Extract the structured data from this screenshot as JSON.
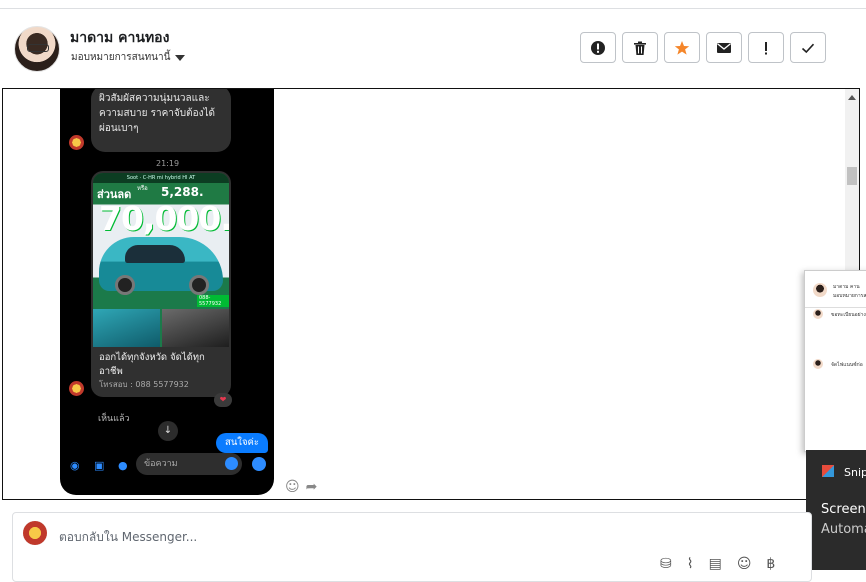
{
  "header": {
    "contact_name": "มาดาม คานทอง",
    "assign_label": "มอบหมายการสนทนานี้"
  },
  "actions": [
    {
      "name": "spam-button",
      "glyph": "!"
    },
    {
      "name": "delete-button",
      "glyph": "🗑"
    },
    {
      "name": "star-button",
      "glyph": "★"
    },
    {
      "name": "mark-unread-button",
      "glyph": "✉"
    },
    {
      "name": "important-button",
      "glyph": "!"
    },
    {
      "name": "done-button",
      "glyph": "✓"
    }
  ],
  "screenshot": {
    "message_text": "ผิวสัมผัสความนุ่มนวลและความสบาย ราคาจับต้องได้ ผ่อนเบาๆ",
    "time": "21:19",
    "ad_top": "Soot · C-HR mi hybrid HI AT",
    "ad_sale": "ส่วนลด",
    "ad_or": "หรือ",
    "ad_monthly": "5,288.",
    "ad_price": "70,000.-",
    "ad_phone": "088-5577932",
    "card_text": "ออกได้ทุกจังหวัด จัดได้ทุกอาชีพ",
    "card_phone": "โทรสอบ : 088 5577932",
    "heart": "❤",
    "seen": "เห็นแล้ว",
    "down": "↓",
    "reply": "สนใจค่ะ",
    "composer_placeholder": "ข้อความ"
  },
  "popup": {
    "name": "มาดาม คาน",
    "sub": "มอบหมายการสนทนา",
    "msg1": "ขอทะเบียนอย่าง",
    "msg2": "จัดไฟแนนซ์ก่อ"
  },
  "toast": {
    "app": "Snip",
    "line1": "Screens",
    "line2": "Automa"
  },
  "reply_box": {
    "placeholder": "ตอบกลับใน Messenger..."
  }
}
